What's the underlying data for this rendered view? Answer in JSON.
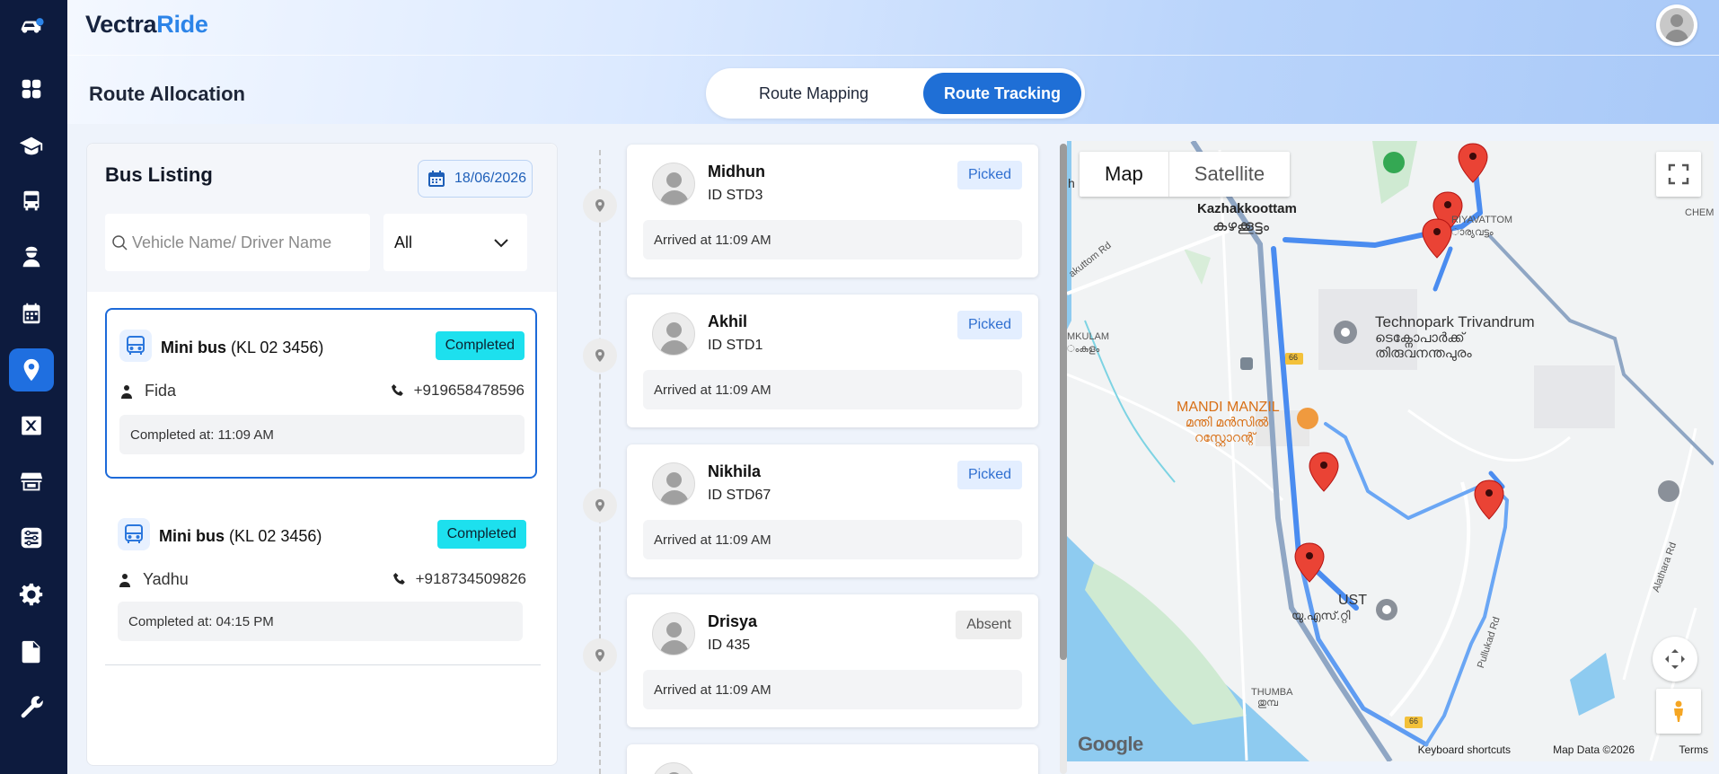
{
  "app": {
    "brand_part1": "Vectra",
    "brand_part2": "Ride",
    "page_title": "Route Allocation",
    "accent_color": "#1f6fd6",
    "sidebar_color": "#0d1b3e"
  },
  "sidebar": {
    "items": [
      {
        "icon": "car-location-icon",
        "active": false
      },
      {
        "icon": "dashboard-icon",
        "active": false
      },
      {
        "icon": "graduation-cap-icon",
        "active": false
      },
      {
        "icon": "bus-icon",
        "active": false
      },
      {
        "icon": "driver-icon",
        "active": false
      },
      {
        "icon": "calendar-icon",
        "active": false
      },
      {
        "icon": "location-pin-icon",
        "active": true
      },
      {
        "icon": "route-map-icon",
        "active": false
      },
      {
        "icon": "store-icon",
        "active": false
      },
      {
        "icon": "list-settings-icon",
        "active": false
      },
      {
        "icon": "gear-icon",
        "active": false
      },
      {
        "icon": "document-icon",
        "active": false
      },
      {
        "icon": "wrench-icon",
        "active": false
      }
    ]
  },
  "tabs": {
    "route_mapping": "Route Mapping",
    "route_tracking": "Route Tracking",
    "active": "route_tracking"
  },
  "bus_listing": {
    "title": "Bus Listing",
    "date": "18/06/2026",
    "search_placeholder": "Vehicle Name/ Driver Name",
    "filter_value": "All",
    "buses": [
      {
        "type": "Mini bus",
        "plate": "(KL 02 3456)",
        "status": "Completed",
        "driver": "Fida",
        "phone": "+919658478596",
        "completed_at": "Completed at: 11:09 AM",
        "selected": true
      },
      {
        "type": "Mini bus",
        "plate": "(KL 02 3456)",
        "status": "Completed",
        "driver": "Yadhu",
        "phone": "+918734509826",
        "completed_at": "Completed at: 04:15 PM",
        "selected": false
      }
    ]
  },
  "students": [
    {
      "name": "Midhun",
      "id": "ID STD3",
      "status": "Picked",
      "arrived": "Arrived at 11:09 AM"
    },
    {
      "name": "Akhil",
      "id": "ID STD1",
      "status": "Picked",
      "arrived": "Arrived at 11:09 AM"
    },
    {
      "name": "Nikhila",
      "id": "ID STD67",
      "status": "Picked",
      "arrived": "Arrived at 11:09 AM"
    },
    {
      "name": "Drisya",
      "id": "ID 435",
      "status": "Absent",
      "arrived": "Arrived at 11:09 AM"
    }
  ],
  "map": {
    "type_map": "Map",
    "type_satellite": "Satellite",
    "labels": {
      "kazhakkoottam": "Kazhakkoottam",
      "kazhakkoottam_ml": "കഴക്കൂട്ടം",
      "technopark": "Technopark Trivandrum",
      "technopark_ml1": "ടെക്നോപാർക്ക്",
      "technopark_ml2": "തിരുവനന്തപുരം",
      "mandi": "MANDI MANZIL",
      "mandi_ml1": "മന്തി മൻസിൽ",
      "mandi_ml2": "റസ്റ്റോറന്റ്",
      "ust": "UST",
      "ust_ml": "യു.എസ്.റ്റി",
      "thumba": "THUMBA",
      "thumba_ml": "തുമ്പ",
      "mkulam": "MKULAM",
      "mkulam_ml": "ംകുളം",
      "kariyavattom": "RIYAVATTOM",
      "kariyavattom_ml": "ാര്യവട്ടം",
      "chemi": "CHEMI",
      "kuttom_rd": "akuttom Rd",
      "pullukad_rd": "Pullukad Rd",
      "alathara_rd": "Alathara Rd",
      "nh66a": "66",
      "nh66b": "66",
      "edge_h": "h"
    },
    "route_color": "#4a8cf0",
    "google": "Google",
    "keyboard_shortcuts": "Keyboard shortcuts",
    "map_data": "Map Data ©2026",
    "terms": "Terms"
  }
}
